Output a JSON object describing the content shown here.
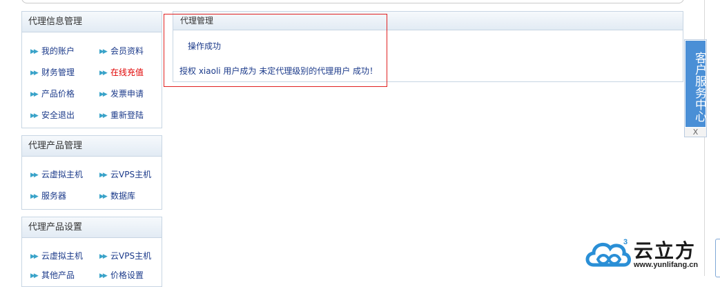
{
  "sidebar": {
    "panel1": {
      "title": "代理信息管理",
      "items": [
        {
          "label": "我的账户"
        },
        {
          "label": "会员资料"
        },
        {
          "label": "财务管理"
        },
        {
          "label": "在线充值"
        },
        {
          "label": "产品价格"
        },
        {
          "label": "发票申请"
        },
        {
          "label": "安全退出"
        },
        {
          "label": "重新登陆"
        }
      ]
    },
    "panel2": {
      "title": "代理产品管理",
      "items": [
        {
          "label": "云虚拟主机"
        },
        {
          "label": "云VPS主机"
        },
        {
          "label": "服务器"
        },
        {
          "label": "数据库"
        }
      ]
    },
    "panel3": {
      "title": "代理产品设置",
      "items": [
        {
          "label": "云虚拟主机"
        },
        {
          "label": "云VPS主机"
        },
        {
          "label": "其他产品"
        },
        {
          "label": "价格设置"
        }
      ]
    }
  },
  "main": {
    "title": "代理管理",
    "message": "操作成功",
    "detail": "授权 xiaoli 用户成为 未定代理级别的代理用户 成功！"
  },
  "service_tab": {
    "label": "客户服务中心",
    "close": "X"
  },
  "logo": {
    "name": "云立方",
    "url": "www.yunlifang.cn",
    "superscript": "3"
  },
  "colors": {
    "link": "#1b3a8a",
    "highlight": "#e00000",
    "accent_blue": "#4a8fd6",
    "annotation_red": "#e02020"
  }
}
